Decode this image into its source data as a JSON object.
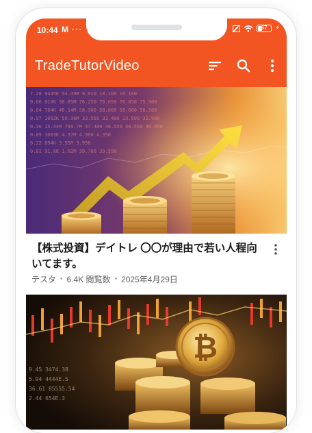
{
  "status_bar": {
    "time": "10:44",
    "left_icons": "M ···",
    "battery": "67"
  },
  "app_bar": {
    "title": "TradeTutorVideo",
    "actions": [
      "sort-icon",
      "search-icon",
      "more-vert-icon"
    ]
  },
  "videos": [
    {
      "title": "【株式投資】デイトレ 〇〇が理由で若い人程向いてます。",
      "channel": "テスタ",
      "views": "6.4K 閲覧数",
      "date": "2025年4月29日",
      "thumbnail": "stock-chart-coins"
    },
    {
      "thumbnail": "bitcoin-coins-chart"
    }
  ],
  "colors": {
    "accent": "#f25522",
    "title_text": "#1a1a1a",
    "sub_text": "#606060"
  }
}
